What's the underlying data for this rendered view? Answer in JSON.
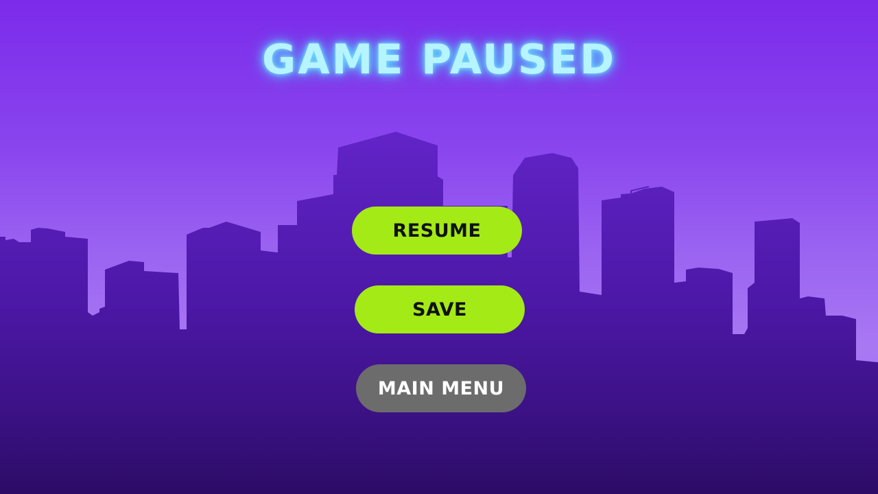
{
  "screen": {
    "title": "GAME PAUSED"
  },
  "menu": {
    "resume_label": "RESUME",
    "save_label": "SAVE",
    "main_menu_label": "MAIN MENU"
  },
  "colors": {
    "sky_top": "#7b2bea",
    "sky_bottom": "#a878f3",
    "skyline": "#4a1aa0",
    "title_glow": "#b6f4ff",
    "primary_button": "#a4ea16",
    "secondary_button": "#6c6c6c"
  }
}
